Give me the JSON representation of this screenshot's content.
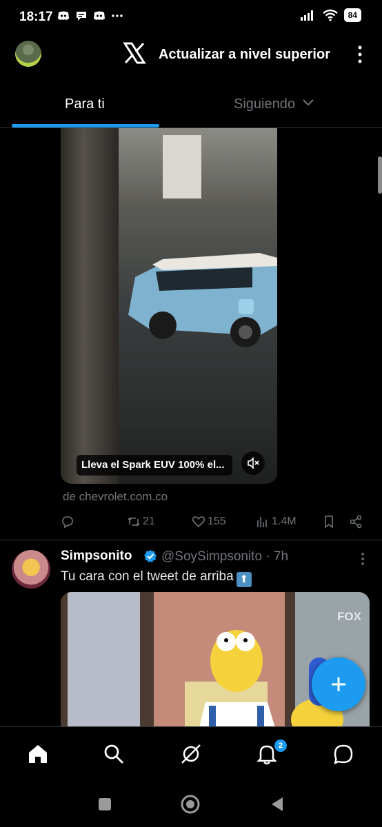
{
  "status_bar": {
    "time": "18:17",
    "battery": "84",
    "icons": [
      "discord-icon",
      "chat-bubble-icon",
      "discord-icon",
      "more-dots-icon",
      "signal-icon",
      "wifi-icon",
      "battery-icon"
    ]
  },
  "header": {
    "upgrade_label": "Actualizar a nivel superior",
    "logo": "x-logo-icon"
  },
  "tabs": [
    {
      "label": "Para ti",
      "active": true
    },
    {
      "label": "Siguiendo",
      "active": false
    }
  ],
  "tweet1": {
    "video_caption": "Lleva el Spark EUV 100% el...",
    "source": "de chevrolet.com.co",
    "actions": {
      "reply": "",
      "retweets": "21",
      "likes": "155",
      "views": "1.4M"
    }
  },
  "tweet2": {
    "name": "Simpsonito",
    "handle": "@SoySimpsonito · 7h",
    "text": "Tu cara con el tweet de arriba",
    "emoji": "⬆",
    "media_watermark": "FOX"
  },
  "bottom_nav": {
    "items": [
      "home-icon",
      "search-icon",
      "grok-icon",
      "notifications-icon",
      "messages-icon"
    ],
    "notifications_badge": "2"
  },
  "colors": {
    "accent": "#1d9bf0",
    "background": "#000000",
    "muted_text": "#71767b",
    "divider": "#2f3336"
  }
}
